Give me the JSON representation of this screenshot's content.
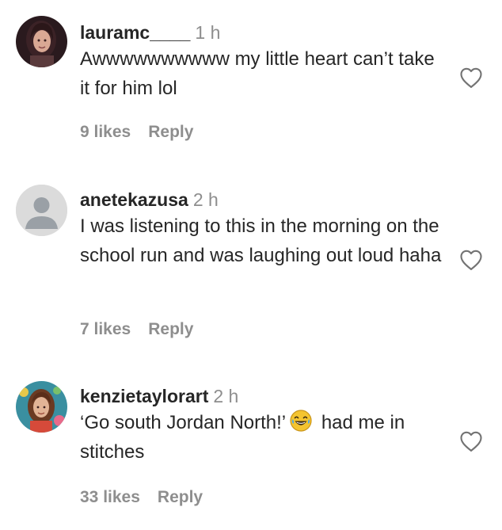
{
  "comments": [
    {
      "username": "lauramc____",
      "time": "1 h",
      "text": "Awwwwwwwwww my little heart can’t take it for him lol",
      "likes": "9 likes",
      "reply": "Reply",
      "avatar_icon": "profile-photo-icon",
      "like_icon": "heart-outline-icon"
    },
    {
      "username": "anetekazusa",
      "time": "2 h",
      "text": "I was listening to this in the morning on the school run and was laughing out loud haha",
      "likes": "7 likes",
      "reply": "Reply",
      "avatar_icon": "default-user-icon",
      "like_icon": "heart-outline-icon"
    },
    {
      "username": "kenzietaylorart",
      "time": "2 h",
      "text_before_emoji": "‘Go south Jordan North!’",
      "emoji": "😂",
      "text_after_emoji": "had me in stitches",
      "likes": "33 likes",
      "reply": "Reply",
      "avatar_icon": "profile-photo-icon",
      "like_icon": "heart-outline-icon"
    }
  ],
  "colors": {
    "primary_text": "#262626",
    "secondary_text": "#8e8e8e",
    "default_avatar_bg": "#dbdbdb",
    "default_avatar_fg": "#9aa0a6"
  }
}
